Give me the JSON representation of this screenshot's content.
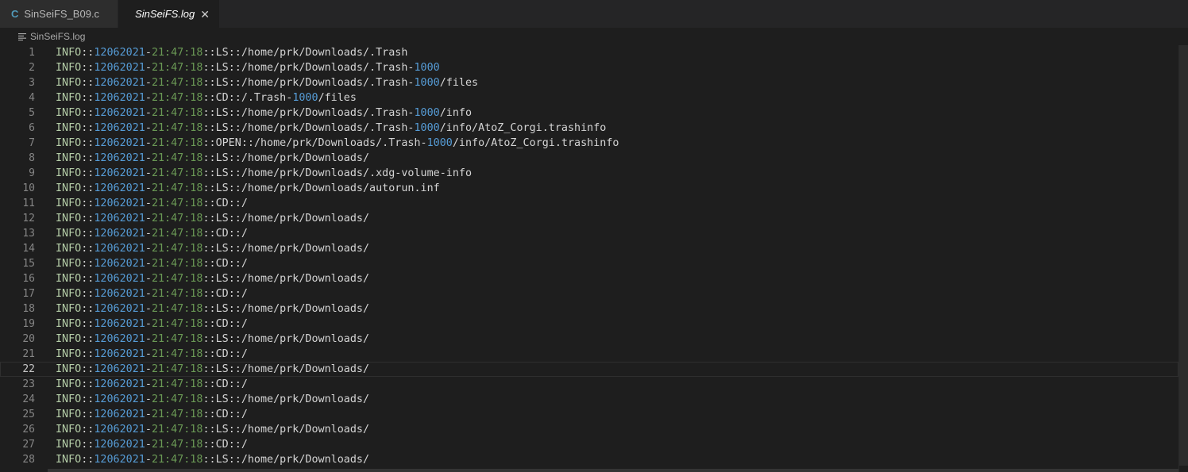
{
  "tabs": [
    {
      "label": "SinSeiFS_B09.c",
      "icon": "c-file-icon",
      "active": false
    },
    {
      "label": "SinSeiFS.log",
      "icon": "log-file-icon",
      "active": true
    }
  ],
  "tab_close_glyph": "✕",
  "c_glyph": "C",
  "breadcrumb": {
    "file": "SinSeiFS.log",
    "icon": "log-file-icon"
  },
  "editor": {
    "current_line": 22,
    "lines": [
      {
        "n": "1",
        "level": "INFO",
        "date": "12062021",
        "time": "21:47:18",
        "op": "LS",
        "arg": "/home/prk/Downloads/.Trash"
      },
      {
        "n": "2",
        "level": "INFO",
        "date": "12062021",
        "time": "21:47:18",
        "op": "LS",
        "arg": "/home/prk/Downloads/.Trash-1000"
      },
      {
        "n": "3",
        "level": "INFO",
        "date": "12062021",
        "time": "21:47:18",
        "op": "LS",
        "arg": "/home/prk/Downloads/.Trash-1000/files"
      },
      {
        "n": "4",
        "level": "INFO",
        "date": "12062021",
        "time": "21:47:18",
        "op": "CD",
        "arg": "/.Trash-1000/files"
      },
      {
        "n": "5",
        "level": "INFO",
        "date": "12062021",
        "time": "21:47:18",
        "op": "LS",
        "arg": "/home/prk/Downloads/.Trash-1000/info"
      },
      {
        "n": "6",
        "level": "INFO",
        "date": "12062021",
        "time": "21:47:18",
        "op": "LS",
        "arg": "/home/prk/Downloads/.Trash-1000/info/AtoZ_Corgi.trashinfo"
      },
      {
        "n": "7",
        "level": "INFO",
        "date": "12062021",
        "time": "21:47:18",
        "op": "OPEN",
        "arg": "/home/prk/Downloads/.Trash-1000/info/AtoZ_Corgi.trashinfo"
      },
      {
        "n": "8",
        "level": "INFO",
        "date": "12062021",
        "time": "21:47:18",
        "op": "LS",
        "arg": "/home/prk/Downloads/"
      },
      {
        "n": "9",
        "level": "INFO",
        "date": "12062021",
        "time": "21:47:18",
        "op": "LS",
        "arg": "/home/prk/Downloads/.xdg-volume-info"
      },
      {
        "n": "10",
        "level": "INFO",
        "date": "12062021",
        "time": "21:47:18",
        "op": "LS",
        "arg": "/home/prk/Downloads/autorun.inf"
      },
      {
        "n": "11",
        "level": "INFO",
        "date": "12062021",
        "time": "21:47:18",
        "op": "CD",
        "arg": "/"
      },
      {
        "n": "12",
        "level": "INFO",
        "date": "12062021",
        "time": "21:47:18",
        "op": "LS",
        "arg": "/home/prk/Downloads/"
      },
      {
        "n": "13",
        "level": "INFO",
        "date": "12062021",
        "time": "21:47:18",
        "op": "CD",
        "arg": "/"
      },
      {
        "n": "14",
        "level": "INFO",
        "date": "12062021",
        "time": "21:47:18",
        "op": "LS",
        "arg": "/home/prk/Downloads/"
      },
      {
        "n": "15",
        "level": "INFO",
        "date": "12062021",
        "time": "21:47:18",
        "op": "CD",
        "arg": "/"
      },
      {
        "n": "16",
        "level": "INFO",
        "date": "12062021",
        "time": "21:47:18",
        "op": "LS",
        "arg": "/home/prk/Downloads/"
      },
      {
        "n": "17",
        "level": "INFO",
        "date": "12062021",
        "time": "21:47:18",
        "op": "CD",
        "arg": "/"
      },
      {
        "n": "18",
        "level": "INFO",
        "date": "12062021",
        "time": "21:47:18",
        "op": "LS",
        "arg": "/home/prk/Downloads/"
      },
      {
        "n": "19",
        "level": "INFO",
        "date": "12062021",
        "time": "21:47:18",
        "op": "CD",
        "arg": "/"
      },
      {
        "n": "20",
        "level": "INFO",
        "date": "12062021",
        "time": "21:47:18",
        "op": "LS",
        "arg": "/home/prk/Downloads/"
      },
      {
        "n": "21",
        "level": "INFO",
        "date": "12062021",
        "time": "21:47:18",
        "op": "CD",
        "arg": "/"
      },
      {
        "n": "22",
        "level": "INFO",
        "date": "12062021",
        "time": "21:47:18",
        "op": "LS",
        "arg": "/home/prk/Downloads/"
      },
      {
        "n": "23",
        "level": "INFO",
        "date": "12062021",
        "time": "21:47:18",
        "op": "CD",
        "arg": "/"
      },
      {
        "n": "24",
        "level": "INFO",
        "date": "12062021",
        "time": "21:47:18",
        "op": "LS",
        "arg": "/home/prk/Downloads/"
      },
      {
        "n": "25",
        "level": "INFO",
        "date": "12062021",
        "time": "21:47:18",
        "op": "CD",
        "arg": "/"
      },
      {
        "n": "26",
        "level": "INFO",
        "date": "12062021",
        "time": "21:47:18",
        "op": "LS",
        "arg": "/home/prk/Downloads/"
      },
      {
        "n": "27",
        "level": "INFO",
        "date": "12062021",
        "time": "21:47:18",
        "op": "CD",
        "arg": "/"
      },
      {
        "n": "28",
        "level": "INFO",
        "date": "12062021",
        "time": "21:47:18",
        "op": "LS",
        "arg": "/home/prk/Downloads/"
      }
    ]
  },
  "colors": {
    "background": "#1e1e1e",
    "tabbar": "#252526",
    "level": "#b5cea8",
    "number": "#569cd6",
    "time": "#6a9955",
    "text": "#d4d4d4",
    "c_icon": "#519aba"
  }
}
